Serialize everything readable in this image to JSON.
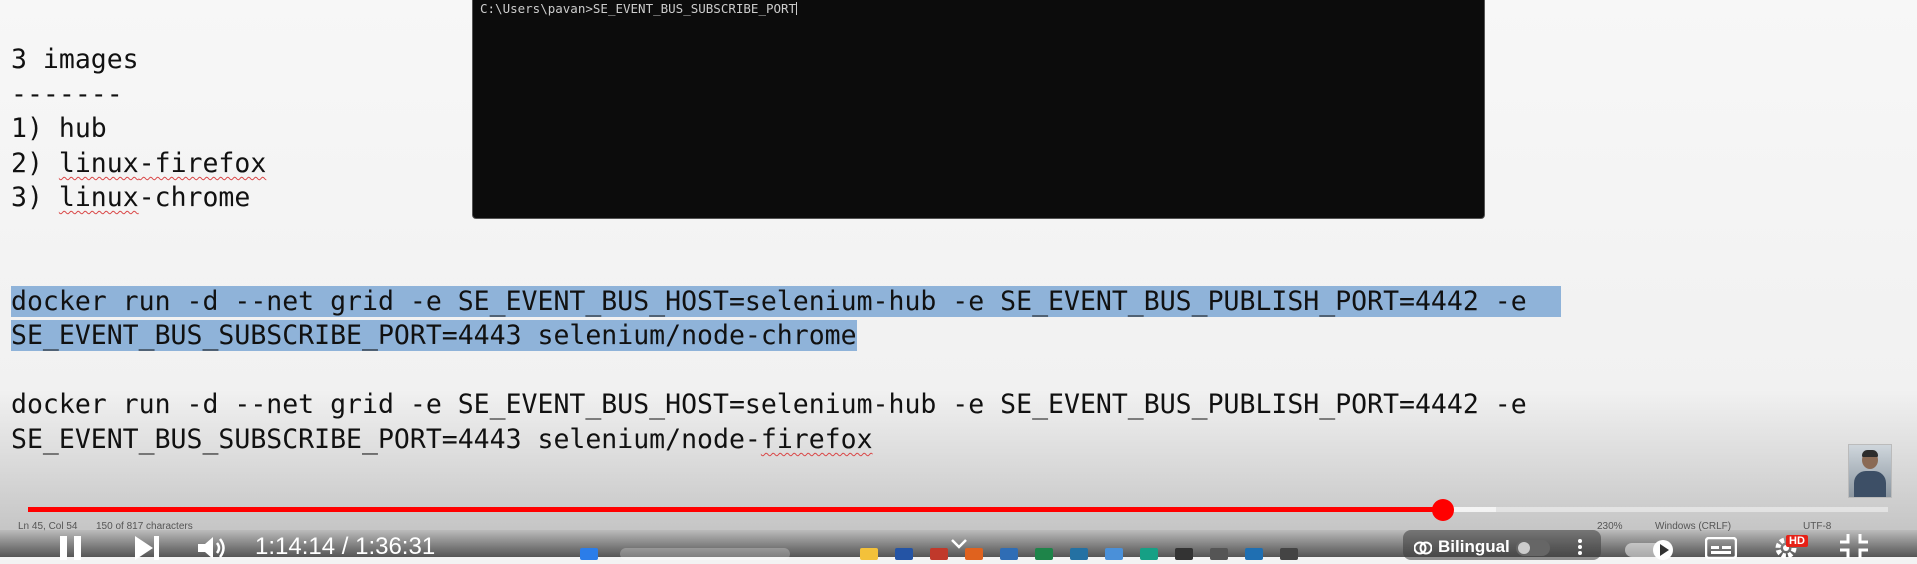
{
  "editor": {
    "lines": [
      {
        "text": "3 images"
      },
      {
        "text": "-------"
      },
      {
        "prefix": "1) ",
        "word": "hub"
      },
      {
        "prefix": "2) ",
        "word": "linux",
        "rest": "-firefox"
      },
      {
        "prefix": "3) ",
        "word": "linux",
        "rest": "-chrome"
      }
    ],
    "cmd1_line1": "docker run -d --net grid -e SE_EVENT_BUS_HOST=selenium-hub -e SE_EVENT_BUS_PUBLISH_PORT=4442 -e",
    "cmd1_line2": "SE_EVENT_BUS_SUBSCRIBE_PORT=4443 selenium/node-chrome",
    "cmd2_line1": "docker run -d --net grid -e SE_EVENT_BUS_HOST=selenium-hub -e SE_EVENT_BUS_PUBLISH_PORT=4442 -e",
    "cmd2_line2_a": "SE_EVENT_BUS_SUBSCRIBE_PORT=4443 selenium/node-",
    "cmd2_line2_b": "firefox"
  },
  "terminal": {
    "prompt": "C:\\Users\\pavan>",
    "input": "SE_EVENT_BUS_SUBSCRIBE_PORT"
  },
  "statusbar": {
    "position": "Ln 45, Col 54",
    "characters": "150 of 817 characters",
    "zoom": "230%",
    "line_endings": "Windows (CRLF)",
    "encoding": "UTF-8"
  },
  "player": {
    "current_time": "1:14:14",
    "separator": " / ",
    "duration": "1:36:31",
    "progress_fraction": 0.7606,
    "buffered_fraction": 0.789,
    "bilingual_label": "Bilingual",
    "quality_badge": "HD",
    "played_color": "#ff0000"
  },
  "icons": {
    "pause": "pause-icon",
    "next": "next-icon",
    "volume": "volume-icon",
    "menu": "more-vert-icon",
    "autoplay": "autoplay-icon",
    "subtitles": "subtitles-icon",
    "settings": "gear-icon",
    "fullscreen": "exit-fullscreen-icon",
    "chevron": "chevron-down-icon"
  }
}
